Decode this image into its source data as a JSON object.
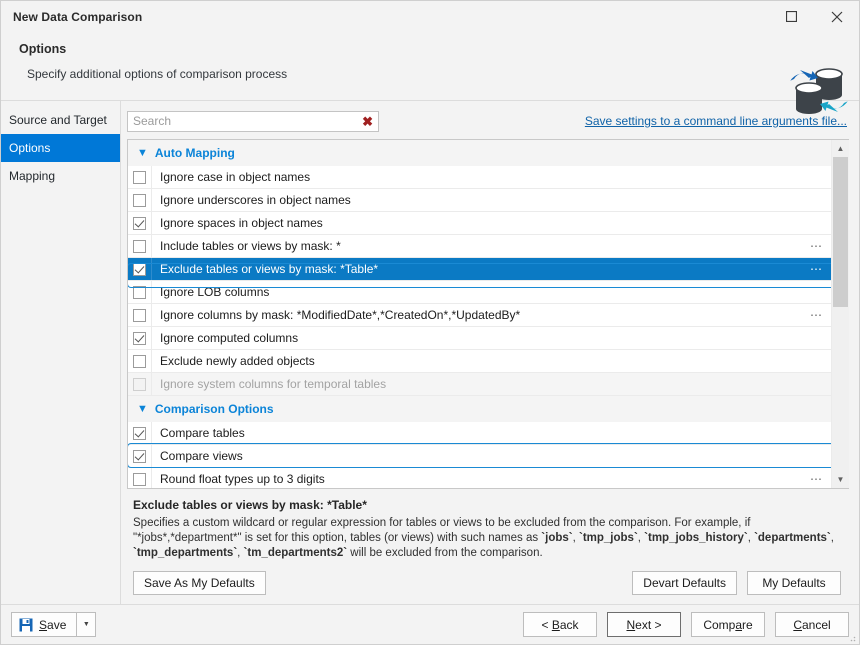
{
  "window": {
    "title": "New Data Comparison",
    "buttons": {
      "maximize": "maximize-icon",
      "close": "close-icon"
    }
  },
  "header": {
    "title": "Options",
    "subtitle": "Specify additional options of comparison process",
    "logo": "database-sync-icon"
  },
  "sidebar": {
    "items": [
      {
        "label": "Source and Target",
        "selected": false
      },
      {
        "label": "Options",
        "selected": true
      },
      {
        "label": "Mapping",
        "selected": false
      }
    ]
  },
  "search": {
    "value": "",
    "placeholder": "Search",
    "clear_icon": "clear-x-icon"
  },
  "links": {
    "save_settings": "Save settings to a command line arguments file..."
  },
  "options": {
    "groups": [
      {
        "label": "Auto Mapping",
        "expanded": true,
        "rows": [
          {
            "label": "Ignore case in object names",
            "checked": false,
            "ellipsis": false,
            "selected": false,
            "disabled": false
          },
          {
            "label": "Ignore underscores in object names",
            "checked": false,
            "ellipsis": false,
            "selected": false,
            "disabled": false
          },
          {
            "label": "Ignore spaces in object names",
            "checked": true,
            "ellipsis": false,
            "selected": false,
            "disabled": false
          },
          {
            "label": "Include tables or views by mask: *",
            "checked": false,
            "ellipsis": true,
            "selected": false,
            "disabled": false
          },
          {
            "label": "Exclude tables or views by mask: *Table*",
            "checked": true,
            "ellipsis": true,
            "selected": true,
            "disabled": false
          },
          {
            "label": "Ignore LOB columns",
            "checked": false,
            "ellipsis": false,
            "selected": false,
            "disabled": false
          },
          {
            "label": "Ignore columns by mask: *ModifiedDate*,*CreatedOn*,*UpdatedBy*",
            "checked": false,
            "ellipsis": true,
            "selected": false,
            "disabled": false
          },
          {
            "label": "Ignore computed columns",
            "checked": true,
            "ellipsis": false,
            "selected": false,
            "disabled": false
          },
          {
            "label": "Exclude newly added objects",
            "checked": false,
            "ellipsis": false,
            "selected": false,
            "disabled": false
          },
          {
            "label": "Ignore system columns for temporal tables",
            "checked": false,
            "ellipsis": false,
            "selected": false,
            "disabled": true
          }
        ]
      },
      {
        "label": "Comparison Options",
        "expanded": true,
        "rows": [
          {
            "label": "Compare tables",
            "checked": true,
            "ellipsis": false,
            "selected": false,
            "disabled": false,
            "focused": false
          },
          {
            "label": "Compare views",
            "checked": true,
            "ellipsis": false,
            "selected": false,
            "disabled": false,
            "focused": true
          },
          {
            "label": "Round float types up to 3 digits",
            "checked": false,
            "ellipsis": true,
            "selected": false,
            "disabled": false,
            "focused": false
          }
        ]
      }
    ],
    "scrollbar": {
      "up": "scroll-up-arrow-icon",
      "down": "scroll-down-arrow-icon"
    }
  },
  "description": {
    "title": "Exclude tables or views by mask: *Table*",
    "line1_a": "Specifies a custom wildcard or regular expression for tables or views to be excluded from the comparison. For example, if \"*jobs*,*department*\" is set for this option, tables (or views) with such names as ",
    "t1": "`jobs`",
    "sep1": ", ",
    "t2": "`tmp_jobs`",
    "sep2": ", ",
    "t3": "`tmp_jobs_history`",
    "sep3": ", ",
    "t4": "`departments`",
    "sep4": ", ",
    "t5": "`tmp_departments`",
    "sep5": ", ",
    "t6": "`tm_departments2`",
    "tail": " will be excluded from the comparison."
  },
  "defaults_bar": {
    "save_as_my_defaults": "Save As My Defaults",
    "devart_defaults": "Devart Defaults",
    "my_defaults": "My Defaults"
  },
  "footer": {
    "save": "Save",
    "save_icon": "floppy-disk-icon",
    "save_caret": "chevron-down-icon",
    "back": "< Back",
    "next": "Next >",
    "compare": "Compare",
    "cancel": "Cancel"
  },
  "colors": {
    "accent_blue": "#0078d7",
    "selection_blue": "#0b7ac4",
    "link_blue": "#1063a8",
    "group_blue": "#0b84d8",
    "window_bg": "#f3f3f3"
  }
}
